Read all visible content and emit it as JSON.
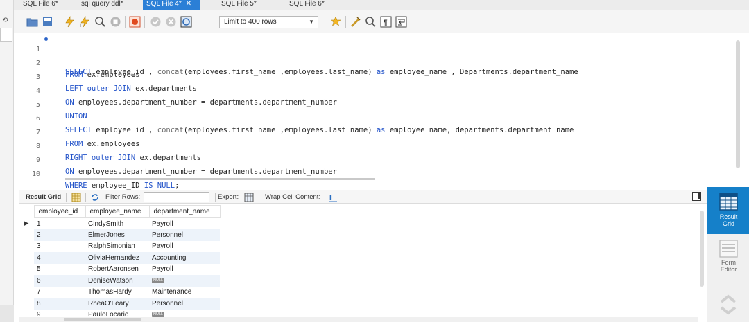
{
  "tabs": [
    {
      "label": "SQL File 6*",
      "active": false
    },
    {
      "label": "sql query ddl*",
      "active": false
    },
    {
      "label": "SQL File 4*",
      "active": true
    },
    {
      "label": "SQL File 5*",
      "active": false
    },
    {
      "label": "SQL File 6*",
      "active": false
    }
  ],
  "toolbar": {
    "limit_label": "Limit to 400 rows",
    "icons": [
      "open-folder-icon",
      "save-icon",
      "execute-icon",
      "execute-current-icon",
      "explain-icon",
      "stop-icon",
      "toggle-error-icon",
      "commit-icon",
      "rollback-icon",
      "autocommit-icon",
      "bookmark-icon",
      "beautify-icon",
      "find-icon",
      "invisible-chars-icon",
      "wrap-icon"
    ]
  },
  "editor": {
    "lines": [
      {
        "no": "1",
        "parts": [
          [
            "k",
            "SELECT"
          ],
          [
            "t",
            " employee_id , "
          ],
          [
            "f",
            "concat"
          ],
          [
            "t",
            "(employees.first_name ,employees.last_name) "
          ],
          [
            "k",
            "as"
          ],
          [
            "t",
            " employee_name , Departments.department_name"
          ]
        ]
      },
      {
        "no": "2",
        "parts": [
          [
            "k",
            "FROM"
          ],
          [
            "t",
            " ex.employees"
          ]
        ]
      },
      {
        "no": "3",
        "parts": [
          [
            "k",
            "LEFT outer JOIN"
          ],
          [
            "t",
            " ex.departments"
          ]
        ]
      },
      {
        "no": "4",
        "parts": [
          [
            "k",
            "ON"
          ],
          [
            "t",
            " employees.department_number = departments.department_number"
          ]
        ]
      },
      {
        "no": "5",
        "parts": [
          [
            "k",
            "UNION"
          ]
        ]
      },
      {
        "no": "6",
        "parts": [
          [
            "k",
            "SELECT"
          ],
          [
            "t",
            " employee_id , "
          ],
          [
            "f",
            "concat"
          ],
          [
            "t",
            "(employees.first_name ,employees.last_name) "
          ],
          [
            "k",
            "as"
          ],
          [
            "t",
            " employee_name, departments.department_name"
          ]
        ]
      },
      {
        "no": "7",
        "parts": [
          [
            "k",
            "FROM"
          ],
          [
            "t",
            " ex.employees"
          ]
        ]
      },
      {
        "no": "8",
        "parts": [
          [
            "k",
            "RIGHT outer JOIN"
          ],
          [
            "t",
            " ex.departments"
          ]
        ]
      },
      {
        "no": "9",
        "parts": [
          [
            "k",
            "ON"
          ],
          [
            "t",
            " employees.department_number = departments.department_number"
          ]
        ]
      },
      {
        "no": "10",
        "parts": [
          [
            "k",
            "WHERE"
          ],
          [
            "t",
            " employee_ID "
          ],
          [
            "k",
            "IS NULL"
          ],
          [
            "t",
            ";"
          ]
        ]
      }
    ]
  },
  "result_toolbar": {
    "result_grid": "Result Grid",
    "filter_rows": "Filter Rows:",
    "export": "Export:",
    "wrap": "Wrap Cell Content:"
  },
  "grid": {
    "columns": [
      "employee_id",
      "employee_name",
      "department_name"
    ],
    "rows": [
      {
        "id": "1",
        "name": "CindySmith",
        "dept": "Payroll"
      },
      {
        "id": "2",
        "name": "ElmerJones",
        "dept": "Personnel"
      },
      {
        "id": "3",
        "name": "RalphSimonian",
        "dept": "Payroll"
      },
      {
        "id": "4",
        "name": "OliviaHernandez",
        "dept": "Accounting"
      },
      {
        "id": "5",
        "name": "RobertAaronsen",
        "dept": "Payroll"
      },
      {
        "id": "6",
        "name": "DeniseWatson",
        "dept": "NULL"
      },
      {
        "id": "7",
        "name": "ThomasHardy",
        "dept": "Maintenance"
      },
      {
        "id": "8",
        "name": "RheaO'Leary",
        "dept": "Personnel"
      },
      {
        "id": "9",
        "name": "PauloLocario",
        "dept": "NULL"
      }
    ],
    "null_label": "NULL"
  },
  "dock": {
    "result_grid_line1": "Result",
    "result_grid_line2": "Grid",
    "form_editor_line1": "Form",
    "form_editor_line2": "Editor"
  },
  "colors": {
    "accent": "#2b7fd6",
    "keyword": "#2353c9",
    "dock_active": "#1580c9"
  }
}
